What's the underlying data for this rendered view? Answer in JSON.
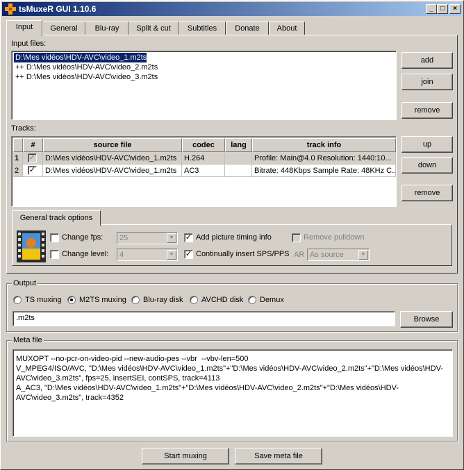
{
  "window": {
    "title": "tsMuxeR GUI 1.10.6",
    "minimize": "_",
    "maximize": "□",
    "close": "×"
  },
  "tabs": [
    "Input",
    "General",
    "Blu-ray",
    "Split & cut",
    "Subtitles",
    "Donate",
    "About"
  ],
  "input": {
    "files_label": "Input files:",
    "files": [
      "D:\\Mes vidéos\\HDV-AVC\\video_1.m2ts",
      "++ D:\\Mes vidéos\\HDV-AVC\\video_2.m2ts",
      "++ D:\\Mes vidéos\\HDV-AVC\\video_3.m2ts"
    ],
    "add": "add",
    "join": "join",
    "remove": "remove"
  },
  "tracks": {
    "label": "Tracks:",
    "headers": [
      "#",
      "source file",
      "codec",
      "lang",
      "track info"
    ],
    "rows": [
      {
        "num": "1",
        "checked": true,
        "source": "D:\\Mes vidéos\\HDV-AVC\\video_1.m2ts",
        "codec": "H.264",
        "lang": "",
        "info": "Profile: Main@4.0  Resolution: 1440:10..."
      },
      {
        "num": "2",
        "checked": true,
        "source": "D:\\Mes vidéos\\HDV-AVC\\video_1.m2ts",
        "codec": "AC3",
        "lang": "",
        "info": "Bitrate: 448Kbps Sample Rate: 48KHz C..."
      }
    ],
    "up": "up",
    "down": "down",
    "remove": "remove"
  },
  "track_options": {
    "tab": "General track options",
    "change_fps": "Change fps:",
    "fps_value": "25",
    "change_level": "Change level:",
    "level_value": "4",
    "add_timing": "Add picture timing info",
    "insert_sps": "Continually insert SPS/PPS",
    "remove_pulldown": "Remove pulldown",
    "ar_label": "AR",
    "ar_value": "As source"
  },
  "output": {
    "group": "Output",
    "modes": [
      "TS muxing",
      "M2TS muxing",
      "Blu-ray disk",
      "AVCHD disk",
      "Demux"
    ],
    "selected": "M2TS muxing",
    "path": ".m2ts",
    "browse": "Browse"
  },
  "meta": {
    "group": "Meta file",
    "text": "MUXOPT --no-pcr-on-video-pid --new-audio-pes --vbr  --vbv-len=500\nV_MPEG4/ISO/AVC, \"D:\\Mes vidéos\\HDV-AVC\\video_1.m2ts\"+\"D:\\Mes vidéos\\HDV-AVC\\video_2.m2ts\"+\"D:\\Mes vidéos\\HDV-AVC\\video_3.m2ts\", fps=25, insertSEI, contSPS, track=4113\nA_AC3, \"D:\\Mes vidéos\\HDV-AVC\\video_1.m2ts\"+\"D:\\Mes vidéos\\HDV-AVC\\video_2.m2ts\"+\"D:\\Mes vidéos\\HDV-AVC\\video_3.m2ts\", track=4352"
  },
  "footer": {
    "start": "Start muxing",
    "save": "Save meta file"
  },
  "colors": {
    "title_start": "#0a246a",
    "title_end": "#a6caf0",
    "face": "#d4d0c8",
    "selection": "#0a246a"
  }
}
